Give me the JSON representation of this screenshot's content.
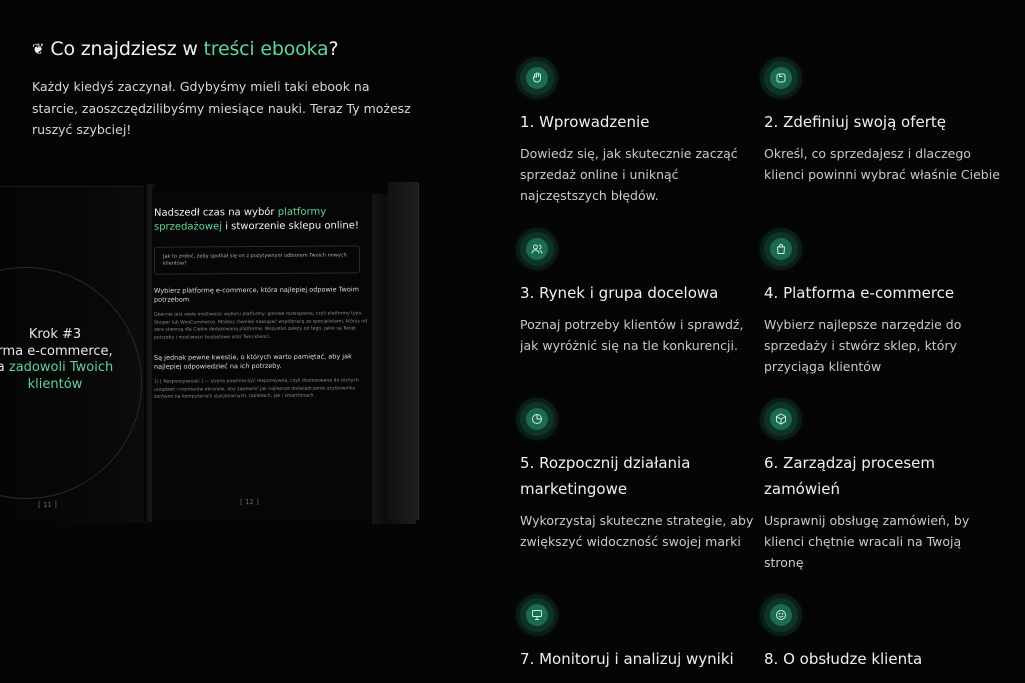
{
  "header": {
    "emoji": "❦",
    "title_prefix": "Co znajdziesz w ",
    "title_accent": "treści ebooka",
    "title_suffix": "?",
    "intro": "Każdy kiedyś zaczynał. Gdybyśmy mieli taki ebook na starcie, zaoszczędzilibyśmy miesiące nauki. Teraz Ty możesz ruszyć szybciej!"
  },
  "book": {
    "left": {
      "step_line1": "Krok #3",
      "step_line2": "rma e-commerce,",
      "step_line3_prefix": "a ",
      "step_line3_accent": "zadowoli Twoich",
      "step_line4_accent": "klientów",
      "page_number": "[ 11 ]"
    },
    "right": {
      "title_prefix": "Nadszedł czas na wybór ",
      "title_accent": "platformy sprzedażowej",
      "title_suffix": " i stworzenie sklepu online!",
      "callout": "Jak to zrobić, żeby spotkał się on z pozytywnym odbiorem Twoich nowych klientów?",
      "subheading": "Wybierz platformę e-commerce, która najlepiej odpowie Twoim potrzebom",
      "body1": "Obecnie jest wiele możliwości wyboru platformy: gotowe rozwiązania, czyli platformy typu Shoper lub WooCommerce. Możesz również nawiązać współpracę ze specjalistami, którzy od zera stworzą dla Ciebie dedykowaną platformę. Wszystko zależy od tego, jakie są Twoje potrzeby i możliwości budżetowe oraz Twoi klienci.",
      "subheading2": "Są jednak pewne kwestie, o których warto pamiętać, aby jak najlepiej odpowiedzieć na ich potrzeby.",
      "body2": "1) [ Responsywność ] — strona powinna być responsywna, czyli dostosowana do różnych urządzeń i rozmiarów ekranów, aby zapewnić jak najlepsze doświadczenie użytkownika zarówno na komputerach stacjonarnych, tabletach, jak i smartfonach.",
      "page_number": "[ 12 ]"
    }
  },
  "features": [
    {
      "icon": "hand-wave-icon",
      "title": "1. Wprowadzenie",
      "desc": "Dowiedz się, jak skutecznie zacząć sprzedaż online i uniknąć najczęstszych błędów."
    },
    {
      "icon": "folder-icon",
      "title": "2. Zdefiniuj swoją ofertę",
      "desc": "Określ, co sprzedajesz i dlaczego klienci powinni wybrać właśnie Ciebie"
    },
    {
      "icon": "users-icon",
      "title": "3. Rynek i grupa docelowa",
      "desc": "Poznaj potrzeby klientów i sprawdź, jak wyróżnić się na tle konkurencji."
    },
    {
      "icon": "shopping-bag-icon",
      "title": "4. Platforma e-commerce",
      "desc": "Wybierz najlepsze narzędzie do sprzedaży i stwórz sklep, który przyciąga klientów"
    },
    {
      "icon": "pie-chart-icon",
      "title": "5. Rozpocznij działania marketingowe",
      "desc": "Wykorzystaj skuteczne strategie, aby zwiększyć widoczność swojej marki"
    },
    {
      "icon": "package-icon",
      "title": "6. Zarządzaj procesem zamówień",
      "desc": "Usprawnij obsługę zamówień, by klienci chętnie wracali na Twoją stronę"
    },
    {
      "icon": "presentation-icon",
      "title": "7. Monitoruj i analizuj wyniki",
      "desc": ""
    },
    {
      "icon": "smile-icon",
      "title": "8. O obsłudze klienta",
      "desc": ""
    }
  ]
}
